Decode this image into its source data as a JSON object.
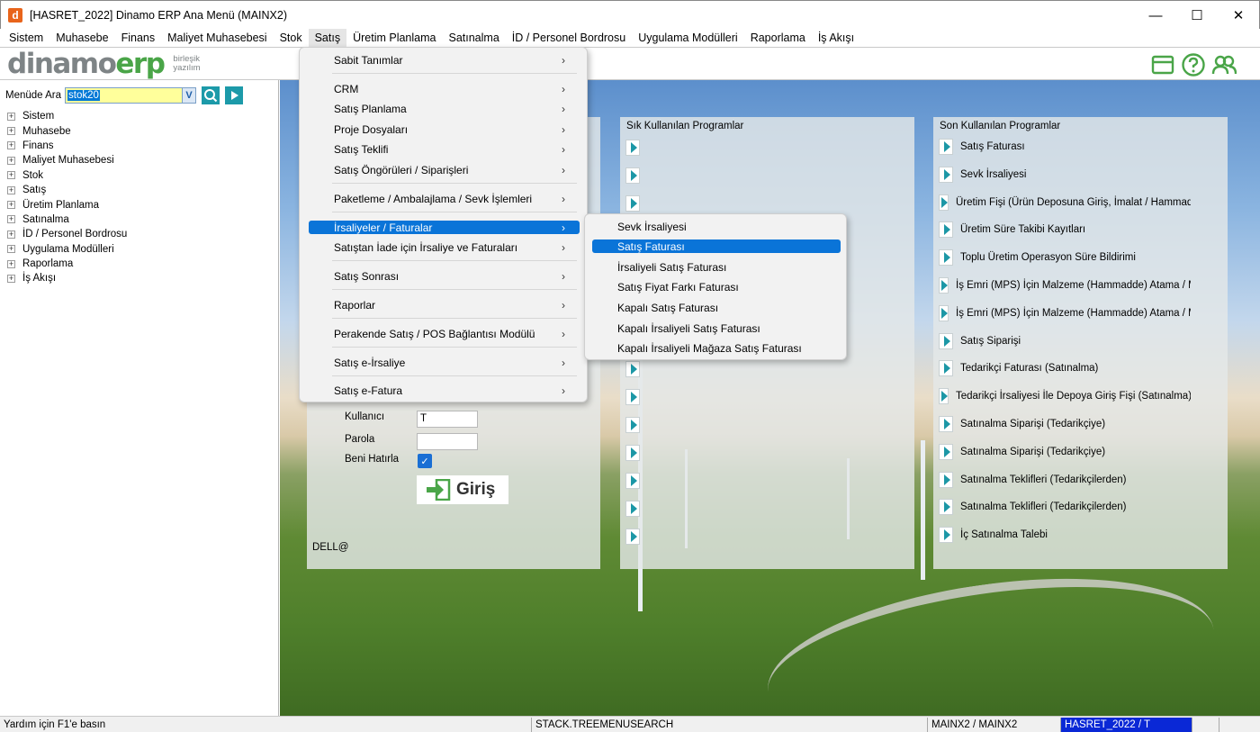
{
  "window": {
    "app_icon_letter": "d",
    "title": "[HASRET_2022] Dinamo ERP Ana Menü (MAINX2)",
    "minimize": "—",
    "maximize": "☐",
    "close": "✕"
  },
  "menubar": [
    "Sistem",
    "Muhasebe",
    "Finans",
    "Maliyet Muhasebesi",
    "Stok",
    "Satış",
    "Üretim Planlama",
    "Satınalma",
    "İD / Personel Bordrosu",
    "Uygulama Modülleri",
    "Raporlama",
    "İş Akışı"
  ],
  "logo": {
    "brand_a": "dinamo",
    "brand_b": "erp",
    "sub_1": "birleşik",
    "sub_2": "yazılım"
  },
  "sidebar": {
    "search_label": "Menüde Ara",
    "search_value": "stok20",
    "dropdown_glyph": "V",
    "tree": [
      "Sistem",
      "Muhasebe",
      "Finans",
      "Maliyet Muhasebesi",
      "Stok",
      "Satış",
      "Üretim Planlama",
      "Satınalma",
      "İD / Personel Bordrosu",
      "Uygulama Modülleri",
      "Raporlama",
      "İş Akışı"
    ]
  },
  "satis_menu": {
    "items": [
      "Sabit Tanımlar",
      "CRM",
      "Satış Planlama",
      "Proje Dosyaları",
      "Satış Teklifi",
      "Satış Öngörüleri / Siparişleri",
      "Paketleme / Ambalajlama / Sevk İşlemleri",
      "İrsaliyeler / Faturalar",
      "Satıştan İade için İrsaliye ve Faturaları",
      "Satış Sonrası",
      "Raporlar",
      "Perakende Satış / POS Bağlantısı Modülü",
      "Satış e-İrsaliye",
      "Satış e-Fatura"
    ],
    "arrow": "›",
    "active_index": 7
  },
  "submenu": {
    "items": [
      "Sevk İrsaliyesi",
      "Satış Faturası",
      "İrsaliyeli Satış Faturası",
      "Satış Fiyat Farkı Faturası",
      "Kapalı Satış Faturası",
      "Kapalı İrsaliyeli Satış Faturası",
      "Kapalı İrsaliyeli Mağaza Satış Faturası"
    ],
    "active_index": 1
  },
  "login": {
    "user_label": "Kullanıcı",
    "user_value": "T",
    "password_label": "Parola",
    "remember_label": "Beni Hatırla",
    "remember_check": "✓",
    "login_button": "Giriş",
    "footer": "DELL@"
  },
  "sik_panel": {
    "title": "Sık Kullanılan Programlar"
  },
  "son_panel": {
    "title": "Son Kullanılan Programlar",
    "items": [
      "Satış Faturası",
      "Sevk İrsaliyesi",
      "Üretim Fişi (Ürün Deposuna Giriş, İmalat / Hammadde",
      "Üretim Süre Takibi Kayıtları",
      "Toplu Üretim Operasyon Süre Bildirimi",
      "İş Emri (MPS) İçin Malzeme (Hammadde) Atama  / Ma",
      "İş Emri (MPS) İçin Malzeme (Hammadde) Atama  / Ma",
      "Satış Siparişi",
      "Tedarikçi Faturası (Satınalma)",
      "Tedarikçi İrsaliyesi İle Depoya Giriş Fişi (Satınalma)",
      "Satınalma Siparişi (Tedarikçiye)",
      "Satınalma Siparişi (Tedarikçiye)",
      "Satınalma Teklifleri (Tedarikçilerden)",
      "Satınalma Teklifleri (Tedarikçilerden)",
      "İç Satınalma Talebi"
    ]
  },
  "statusbar": {
    "help": "Yardım için F1'e basın",
    "context": "STACK.TREEMENUSEARCH",
    "company": "MAINX2 / MAINX2",
    "user": "HASRET_2022 / T"
  },
  "colors": {
    "accent": "#0a74d8",
    "teal": "#1c97a6",
    "logo_green": "#4aa548"
  }
}
